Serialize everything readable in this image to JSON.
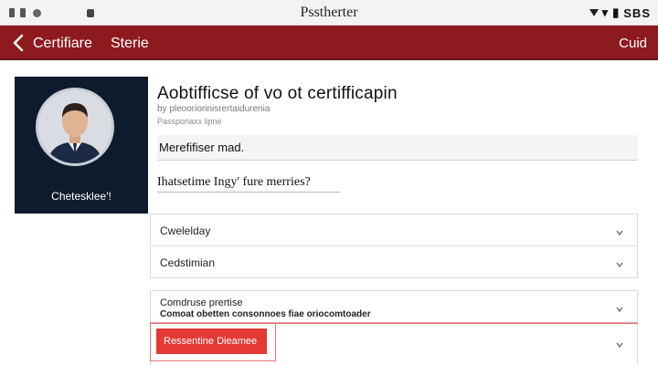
{
  "status_bar": {
    "title": "Psstherter",
    "right_text": "SBS"
  },
  "app_bar": {
    "title": "Certifiare",
    "title2": "Sterie",
    "right_action": "Cuid"
  },
  "profile": {
    "name": "Chetesklee'!"
  },
  "main": {
    "title": "Aobtifficse of vo ot certifficapin",
    "subtitle": "by pleooriorinisrertaidurenia",
    "meta": "Passporiaxx lipne",
    "field_label": "Merefifiser mad.",
    "question": "Ihatsetime Ingy' fure merries?"
  },
  "accordions": [
    {
      "label": "Cwelelday"
    },
    {
      "label": "Cedstimian"
    }
  ],
  "section3": {
    "label": "Comdruse prertise",
    "sublabel": "Comoat obetten consonnoes fiae oriocomtoader"
  },
  "action_button": {
    "label": "Ressentine Dieamee"
  },
  "colors": {
    "header": "#8d1a1f",
    "button": "#e53935",
    "card_bg": "#0e1b2c"
  }
}
